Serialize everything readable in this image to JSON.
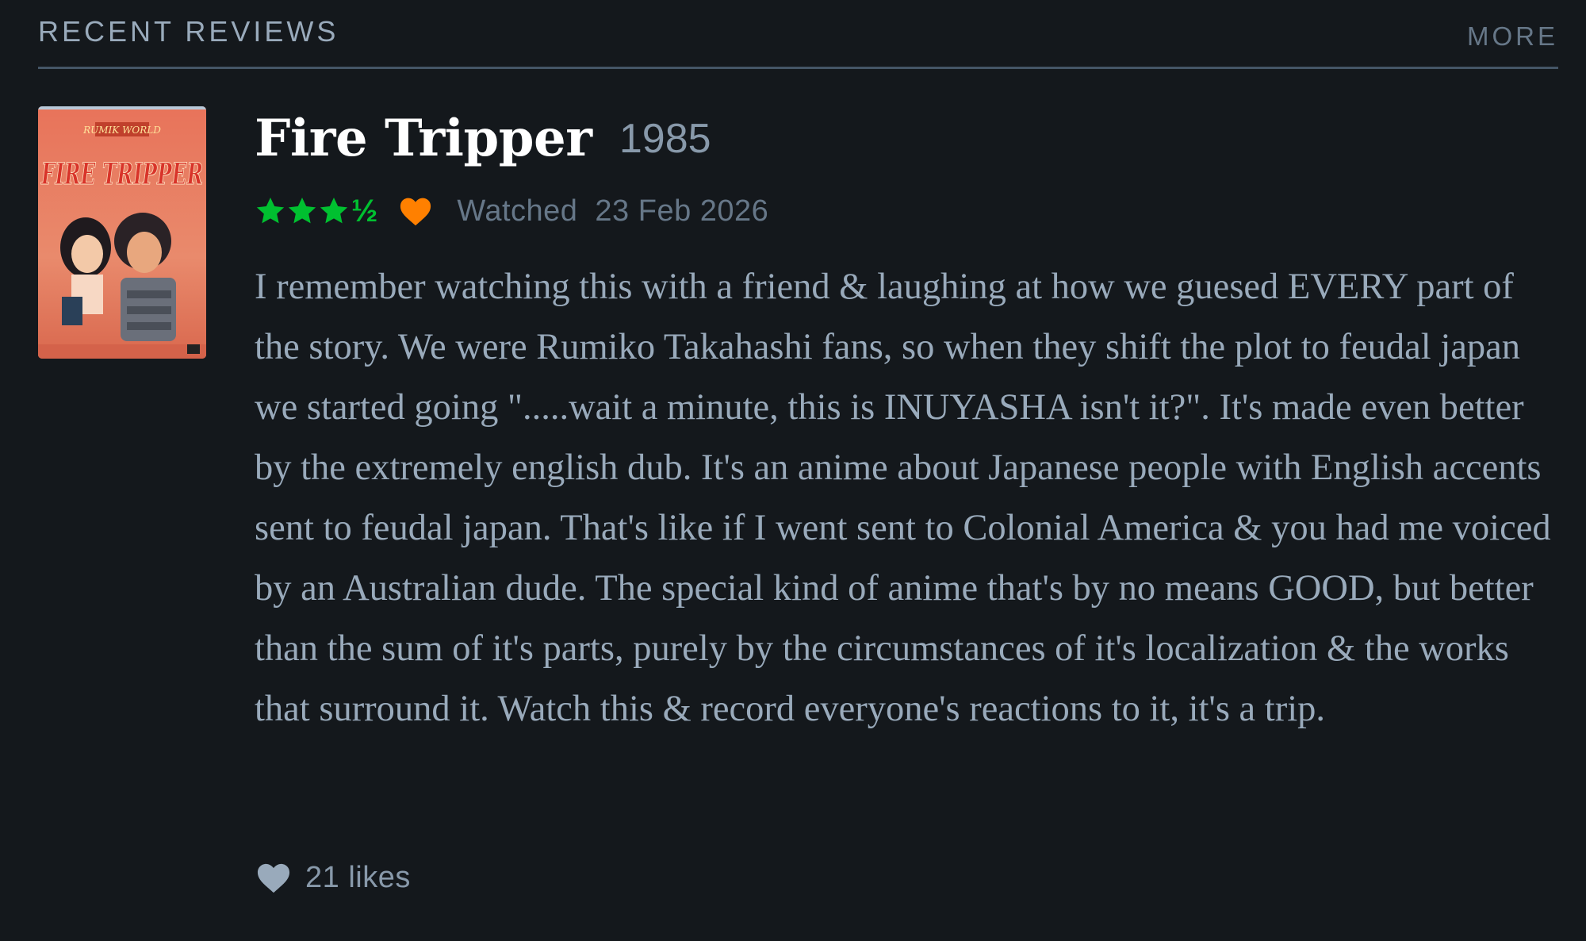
{
  "section": {
    "title": "RECENT REVIEWS",
    "more_label": "MORE"
  },
  "poster": {
    "title_text": "FIRE TRIPPER",
    "label_text": "RUMIK WORLD",
    "icon": "film-poster-image"
  },
  "review": {
    "film_title": "Fire Tripper",
    "film_year": "1985",
    "rating_stars": 3.5,
    "half_star_glyph": "½",
    "liked": true,
    "watched_label": "Watched",
    "watched_date": "23 Feb 2026",
    "body": "I remember watching this with a friend & laughing at how we guesed EVERY part of the story. We were Rumiko Takahashi fans, so when they shift the plot to feudal japan we started going \".....wait a minute, this is INUYASHA isn't it?\". It's made even better by the extremely english dub. It's an anime about Japanese people with English accents sent to feudal japan. That's like if I went sent to Colonial America & you had me voiced by an Australian dude. The special kind of anime that's by no means GOOD, but better than the sum of it's parts, purely by the circumstances of it's localization & the works that surround it. Watch this & record everyone's reactions to it, it's a trip.",
    "likes_count": "21 likes"
  },
  "colors": {
    "background": "#14181c",
    "star_green": "#00c030",
    "like_orange": "#ff8000",
    "muted_text": "#678",
    "body_text": "#9ab"
  }
}
